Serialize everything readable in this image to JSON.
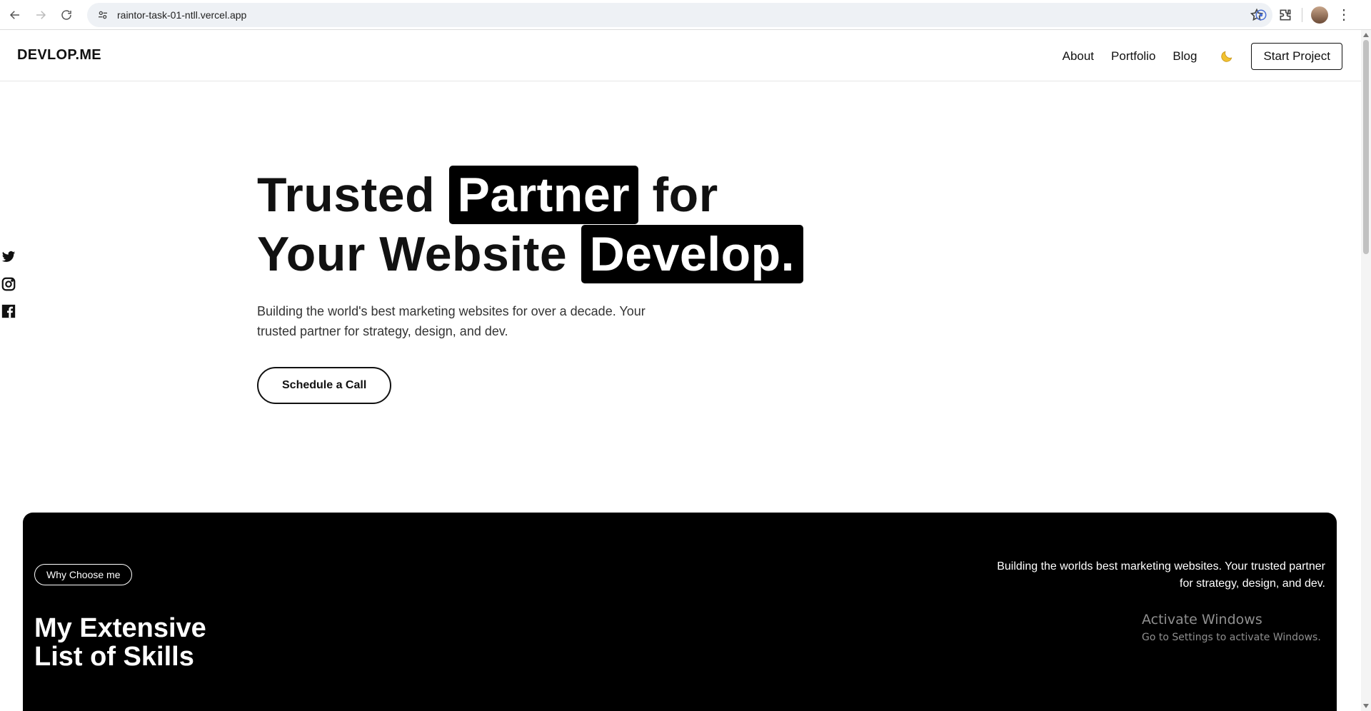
{
  "browser": {
    "url": "raintor-task-01-ntll.vercel.app",
    "icons": [
      "back-arrow-icon",
      "forward-arrow-icon",
      "reload-icon",
      "site-settings-icon",
      "bookmark-star-icon",
      "extension-icon",
      "puzzle-extensions-icon",
      "profile-avatar",
      "more-menu-icon"
    ]
  },
  "header": {
    "logo": "DEVLOP.ME",
    "nav": [
      "About",
      "Portfolio",
      "Blog"
    ],
    "theme_icon": "moon-icon",
    "start_project": "Start Project"
  },
  "social": [
    "twitter-icon",
    "instagram-icon",
    "facebook-icon"
  ],
  "hero": {
    "line1_word1": "Trusted",
    "line1_highlight": "Partner",
    "line1_word3": "for",
    "line2_word1": "Your Website",
    "line2_highlight": "Develop.",
    "description": "Building the world's best marketing websites for over a decade. Your trusted partner for strategy, design, and dev.",
    "cta": "Schedule a Call"
  },
  "skills_section": {
    "pill": "Why Choose me",
    "title_line1": "My Extensive",
    "title_line2": "List of Skills",
    "description": "Building the worlds best marketing websites. Your trusted partner for strategy, design, and dev."
  },
  "watermark": {
    "title": "Activate Windows",
    "subtitle": "Go to Settings to activate Windows."
  },
  "colors": {
    "dark_bg": "#000000",
    "page_bg": "#ffffff",
    "text": "#111111"
  }
}
